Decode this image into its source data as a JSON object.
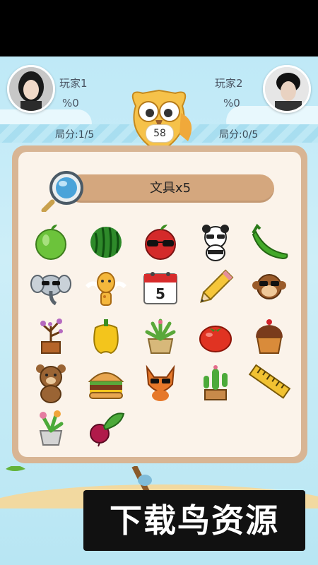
{
  "players": {
    "p1": {
      "name": "玩家1",
      "percent": "%0",
      "round_score": "局分:1/5"
    },
    "p2": {
      "name": "玩家2",
      "percent": "%0",
      "round_score": "局分:0/5"
    }
  },
  "timer": "58",
  "task": {
    "label": "文具x5"
  },
  "items": [
    {
      "name": "green-apple-icon"
    },
    {
      "name": "watermelon-icon"
    },
    {
      "name": "red-apple-sunglasses-icon"
    },
    {
      "name": "panda-icon"
    },
    {
      "name": "green-chili-icon"
    },
    {
      "name": "elephant-icon"
    },
    {
      "name": "giraffe-icon"
    },
    {
      "name": "calendar-icon"
    },
    {
      "name": "pencil-icon"
    },
    {
      "name": "monkey-icon"
    },
    {
      "name": "potted-tree-icon"
    },
    {
      "name": "bell-pepper-icon"
    },
    {
      "name": "basket-plant-icon"
    },
    {
      "name": "tomato-icon"
    },
    {
      "name": "cupcake-icon"
    },
    {
      "name": "bear-icon"
    },
    {
      "name": "burger-icon"
    },
    {
      "name": "fox-icon"
    },
    {
      "name": "cactus-icon"
    },
    {
      "name": "ruler-icon"
    },
    {
      "name": "potted-flower-icon"
    },
    {
      "name": "beet-icon"
    }
  ],
  "calendar_number": "5",
  "watermark": "下载鸟资源",
  "colors": {
    "board_border": "#d8b594",
    "board_bg": "#fbf3ea",
    "task_bar": "#d4a77e",
    "sky": "#bfe9f7"
  }
}
